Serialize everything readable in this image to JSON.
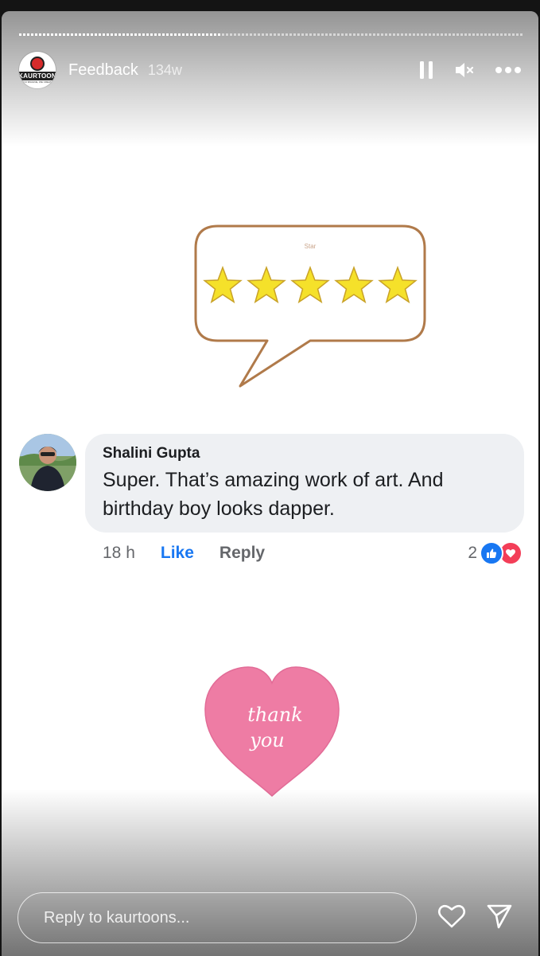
{
  "story": {
    "title": "Feedback",
    "age": "134w",
    "progress_fraction": 0.4,
    "account_logo": {
      "name": "KAURTOON",
      "tagline": "YOU IMAGINE, WE CREATE"
    }
  },
  "controls": {
    "pause_icon": "pause-icon",
    "mute_icon": "speaker-muted-icon",
    "more_icon": "more-horizontal-icon"
  },
  "rating": {
    "stars": 5,
    "max": 5,
    "label": "Star"
  },
  "comment": {
    "author": "Shalini Gupta",
    "text": "Super. That’s amazing work of art. And birthday boy looks dapper.",
    "time": "18 h",
    "like_label": "Like",
    "reply_label": "Reply",
    "reaction_count": "2"
  },
  "thanks": {
    "line1": "thank",
    "line2": "you"
  },
  "footer": {
    "reply_placeholder": "Reply to kaurtoons...",
    "heart_icon": "heart-outline-icon",
    "send_icon": "send-icon"
  },
  "colors": {
    "like_blue": "#1877f2",
    "love_red": "#f33e58",
    "star_yellow": "#f5e12a",
    "heart_pink": "#ee7ca4",
    "bubble_border": "#b07a4a"
  }
}
